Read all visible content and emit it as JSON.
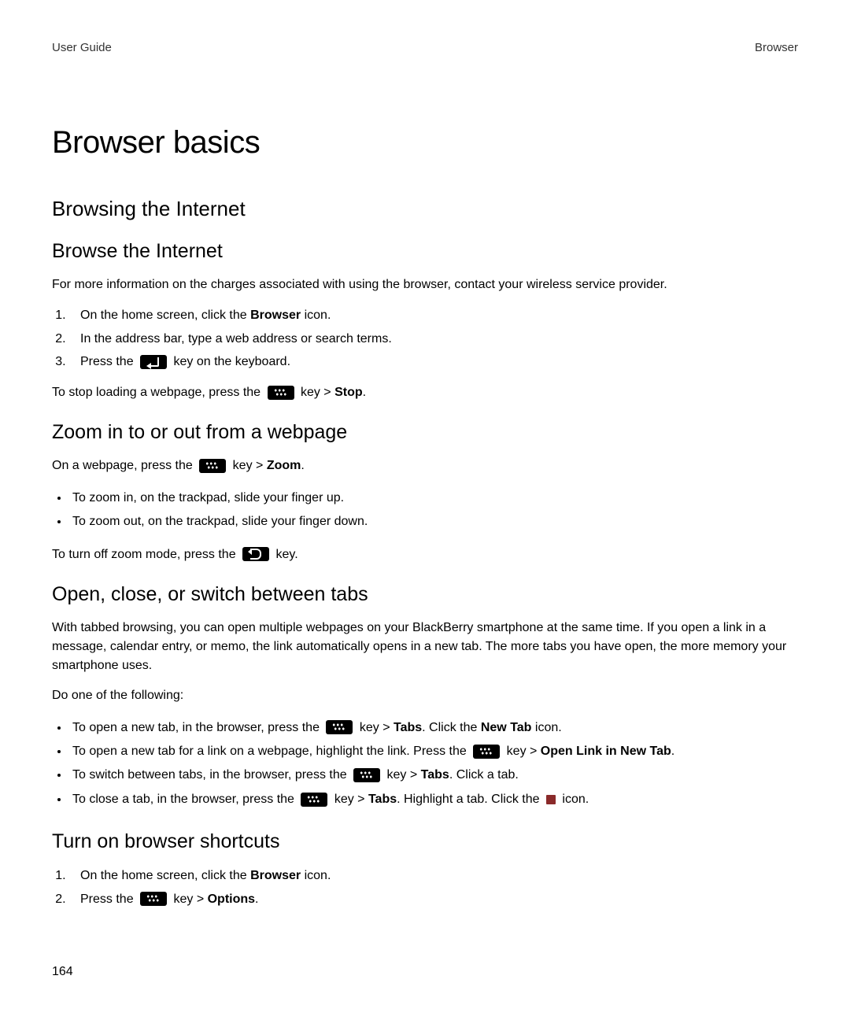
{
  "header": {
    "left": "User Guide",
    "right": "Browser"
  },
  "h1": "Browser basics",
  "s1": {
    "h2": "Browsing the Internet",
    "h3_1": "Browse the Internet",
    "p1": "For more information on the charges associated with using the browser, contact your wireless service provider.",
    "ol1_1a": "On the home screen, click the ",
    "ol1_1b": "Browser",
    "ol1_1c": " icon.",
    "ol1_2": "In the address bar, type a web address or search terms.",
    "ol1_3a": "Press the ",
    "ol1_3b": " key on the keyboard.",
    "p2a": "To stop loading a webpage, press the ",
    "p2b": " key > ",
    "p2c": "Stop",
    "p2d": ".",
    "h3_2": "Zoom in to or out from a webpage",
    "p3a": "On a webpage, press the ",
    "p3b": " key > ",
    "p3c": "Zoom",
    "p3d": ".",
    "ul1_1": "To zoom in, on the trackpad, slide your finger up.",
    "ul1_2": "To zoom out, on the trackpad, slide your finger down.",
    "p4a": "To turn off zoom mode, press the ",
    "p4b": " key.",
    "h3_3": "Open, close, or switch between tabs",
    "p5": "With tabbed browsing, you can open multiple webpages on your BlackBerry smartphone at the same time. If you open a link in a message, calendar entry, or memo, the link automatically opens in a new tab. The more tabs you have open, the more memory your smartphone uses.",
    "p6": "Do one of the following:",
    "ul2_1a": "To open a new tab, in the browser, press the ",
    "ul2_1b": " key > ",
    "ul2_1c": "Tabs",
    "ul2_1d": ". Click the ",
    "ul2_1e": "New Tab",
    "ul2_1f": " icon.",
    "ul2_2a": "To open a new tab for a link on a webpage, highlight the link. Press the ",
    "ul2_2b": " key > ",
    "ul2_2c": "Open Link in New Tab",
    "ul2_2d": ".",
    "ul2_3a": "To switch between tabs, in the browser, press the ",
    "ul2_3b": " key > ",
    "ul2_3c": "Tabs",
    "ul2_3d": ". Click a tab.",
    "ul2_4a": "To close a tab, in the browser, press the ",
    "ul2_4b": " key > ",
    "ul2_4c": "Tabs",
    "ul2_4d": ". Highlight a tab. Click the ",
    "ul2_4e": " icon.",
    "h3_4": "Turn on browser shortcuts",
    "ol2_1a": "On the home screen, click the ",
    "ol2_1b": "Browser",
    "ol2_1c": " icon.",
    "ol2_2a": "Press the ",
    "ol2_2b": " key > ",
    "ol2_2c": "Options",
    "ol2_2d": "."
  },
  "page_number": "164"
}
